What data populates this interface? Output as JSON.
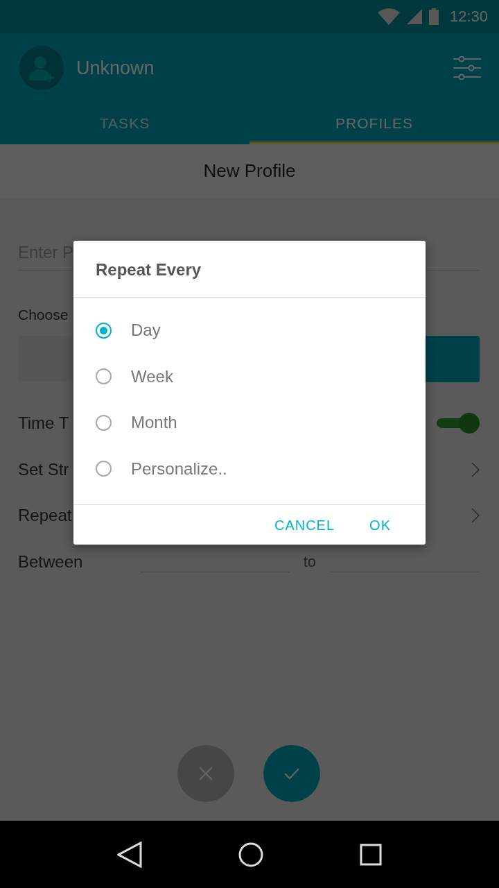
{
  "status_bar": {
    "time": "12:30"
  },
  "app_bar": {
    "user_name": "Unknown"
  },
  "tabs": [
    {
      "label": "TASKS",
      "selected": false
    },
    {
      "label": "PROFILES",
      "selected": true
    }
  ],
  "screen_title": "New Profile",
  "form": {
    "name_field": {
      "placeholder": "Enter P"
    },
    "choose_label": "Choose",
    "choice_options": [
      {
        "selected": false
      },
      {
        "selected": true
      }
    ],
    "rows": [
      {
        "kind": "switch",
        "label": "Time T",
        "on": true
      },
      {
        "kind": "link",
        "label": "Set Str"
      },
      {
        "kind": "link",
        "label": "Repeat"
      },
      {
        "kind": "range",
        "label": "Between",
        "separator": "to"
      }
    ]
  },
  "dialog": {
    "title": "Repeat Every",
    "options": [
      {
        "label": "Day",
        "selected": true
      },
      {
        "label": "Week",
        "selected": false
      },
      {
        "label": "Month",
        "selected": false
      },
      {
        "label": "Personalize..",
        "selected": false
      }
    ],
    "buttons": [
      "CANCEL",
      "OK"
    ]
  }
}
